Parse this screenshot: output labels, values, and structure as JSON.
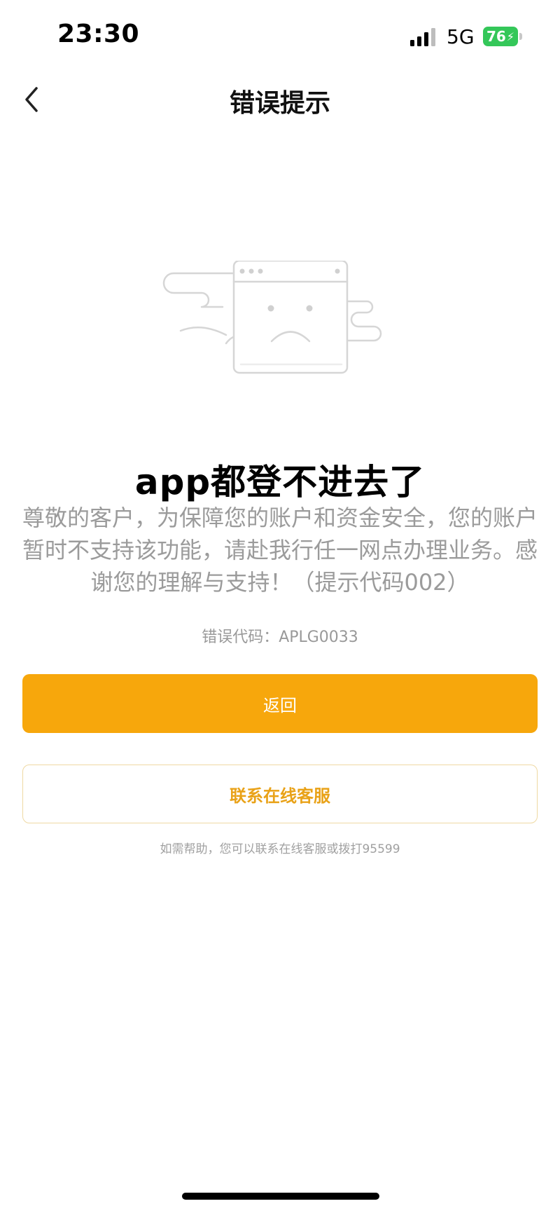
{
  "status_bar": {
    "time": "23:30",
    "network": "5G",
    "battery": "76",
    "battery_color": "#34c759"
  },
  "nav": {
    "back_icon": "chevron-left-icon",
    "title": "错误提示"
  },
  "illustration": "sad-browser-window-with-clouds",
  "error": {
    "headline": "app都登不进去了",
    "message": "尊敬的客户，为保障您的账户和资金安全，您的账户暂时不支持该功能，请赴我行任一网点办理业务。感谢您的理解与支持！（提示代码002）",
    "code_line": "错误代码：APLG0033"
  },
  "buttons": {
    "primary_label": "返回",
    "secondary_label": "联系在线客服"
  },
  "help_text": "如需帮助，您可以联系在线客服或拨打95599",
  "colors": {
    "accent": "#f7a70c",
    "secondary_text": "#e9a218",
    "muted_text": "#9b9b9b"
  }
}
